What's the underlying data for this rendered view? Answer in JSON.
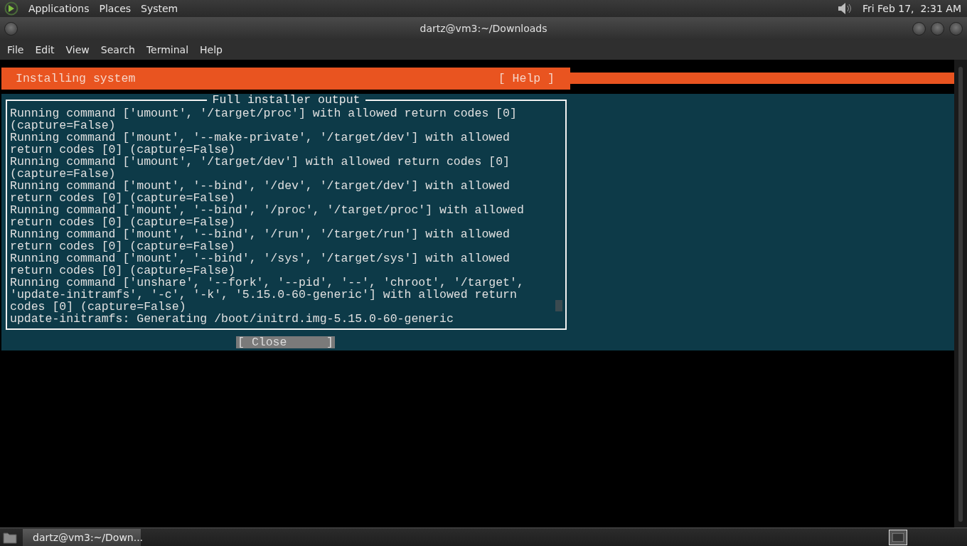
{
  "top_panel": {
    "menus": [
      "Applications",
      "Places",
      "System"
    ],
    "clock": "Fri Feb 17,  2:31 AM"
  },
  "window": {
    "title": "dartz@vm3:~/Downloads"
  },
  "menubar": [
    "File",
    "Edit",
    "View",
    "Search",
    "Terminal",
    "Help"
  ],
  "installer": {
    "header": "Installing system",
    "help": "[ Help ]",
    "dialog": {
      "title": "Full installer output",
      "lines": [
        "Running command ['umount', '/target/proc'] with allowed return codes [0]",
        "(capture=False)",
        "Running command ['mount', '--make-private', '/target/dev'] with allowed",
        "return codes [0] (capture=False)",
        "Running command ['umount', '/target/dev'] with allowed return codes [0]",
        "(capture=False)",
        "Running command ['mount', '--bind', '/dev', '/target/dev'] with allowed",
        "return codes [0] (capture=False)",
        "Running command ['mount', '--bind', '/proc', '/target/proc'] with allowed",
        "return codes [0] (capture=False)",
        "Running command ['mount', '--bind', '/run', '/target/run'] with allowed",
        "return codes [0] (capture=False)",
        "Running command ['mount', '--bind', '/sys', '/target/sys'] with allowed",
        "return codes [0] (capture=False)",
        "Running command ['unshare', '--fork', '--pid', '--', 'chroot', '/target',",
        "'update-initramfs', '-c', '-k', '5.15.0-60-generic'] with allowed return",
        "codes [0] (capture=False)",
        "update-initramfs: Generating /boot/initrd.img-5.15.0-60-generic"
      ]
    },
    "button": {
      "open": "[",
      "label": "Close",
      "close": "]"
    }
  },
  "taskbar": {
    "tasks": [
      {
        "label": "dartz@vm3:~/Down...",
        "selected": true
      }
    ]
  }
}
